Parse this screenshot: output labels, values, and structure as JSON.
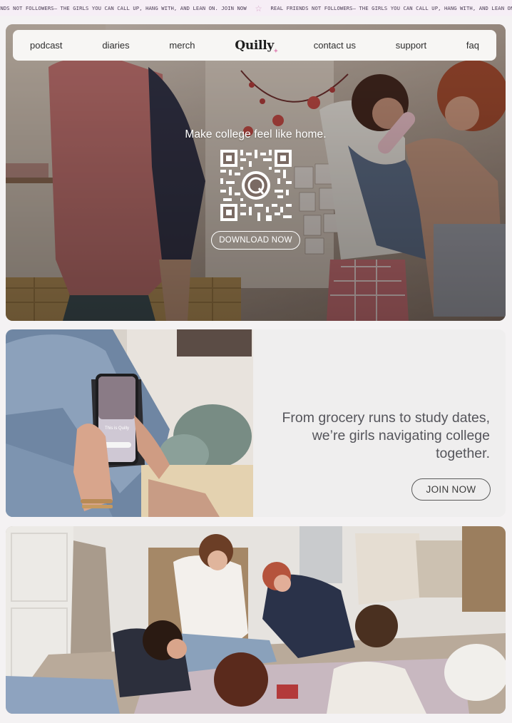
{
  "ticker": {
    "text_a": "ENDS NOT FOLLOWERS— THE GIRLS YOU CAN CALL UP, HANG WITH, AND LEAN ON. JOIN NOW",
    "text_b": "REAL FRIENDS NOT FOLLOWERS— THE GIRLS YOU CAN CALL UP, HANG WITH, AND LEAN ON.",
    "star": "☆"
  },
  "nav": {
    "items": [
      "podcast",
      "diaries",
      "merch",
      "contact us",
      "support",
      "faq"
    ],
    "logo": "Quilly"
  },
  "hero": {
    "tagline": "Make college feel like home.",
    "download_label": "DOWNLOAD NOW"
  },
  "section2": {
    "copy": "From grocery runs to study dates, we’re girls navigating college together.",
    "join_label": "JOIN NOW",
    "phone_title": "This is Quilly"
  },
  "colors": {
    "ticker_bg": "#f6eef6",
    "accent_pink": "#e08ab7",
    "nav_bg": "#f7f6f4",
    "panel_bg": "#efeeee"
  }
}
